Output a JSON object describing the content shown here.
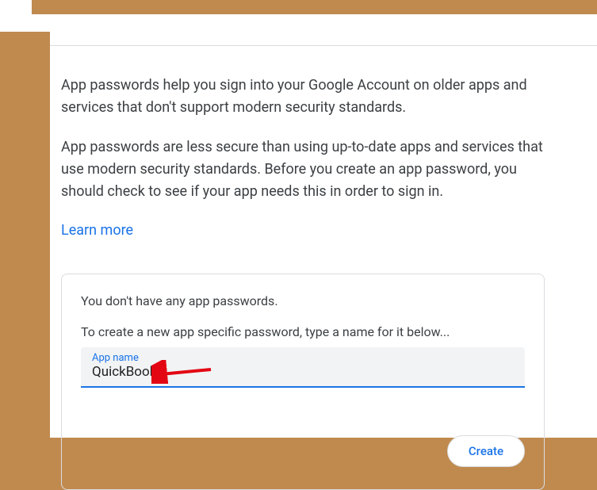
{
  "intro": {
    "para1": "App passwords help you sign into your Google Account on older apps and services that don't support modern security standards.",
    "para2": "App passwords are less secure than using up-to-date apps and services that use modern security standards. Before you create an app password, you should check to see if your app needs this in order to sign in.",
    "learn_more": "Learn more"
  },
  "card": {
    "status": "You don't have any app passwords.",
    "instruction": "To create a new app specific password, type a name for it below...",
    "input_label": "App name",
    "input_value": "QuickBooks",
    "create_label": "Create"
  }
}
